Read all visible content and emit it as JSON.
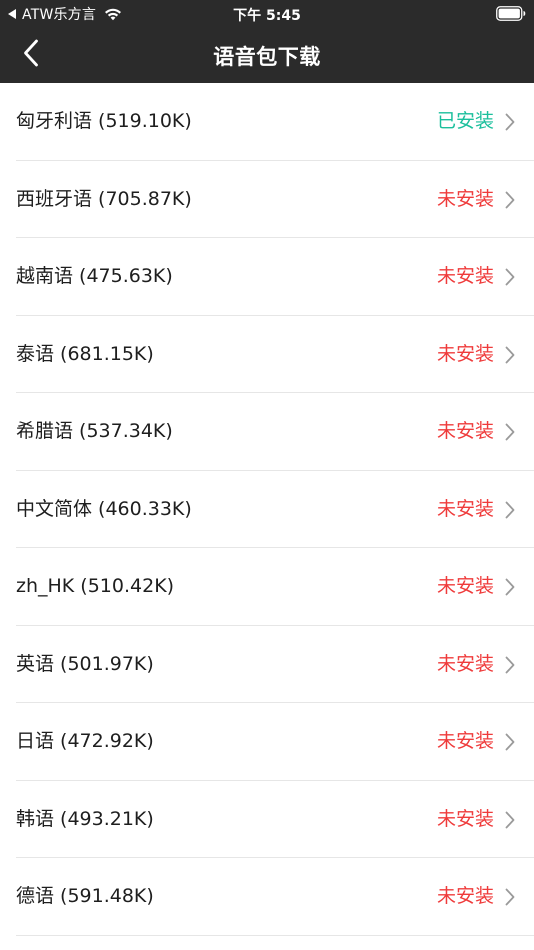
{
  "status_bar": {
    "carrier": "ATW乐方言",
    "time": "下午 5:45"
  },
  "nav": {
    "title": "语音包下载"
  },
  "colors": {
    "installed": "#1bbf9c",
    "not_installed": "#ef3b3b",
    "nav_background": "#2b2b2b"
  },
  "icons": {
    "back": "chevron-left-icon",
    "row_arrow": "chevron-right-icon"
  },
  "items": [
    {
      "label": "匈牙利语 (519.10K)",
      "status": "已安装",
      "installed": true
    },
    {
      "label": "西班牙语 (705.87K)",
      "status": "未安装",
      "installed": false
    },
    {
      "label": "越南语 (475.63K)",
      "status": "未安装",
      "installed": false
    },
    {
      "label": "泰语 (681.15K)",
      "status": "未安装",
      "installed": false
    },
    {
      "label": "希腊语 (537.34K)",
      "status": "未安装",
      "installed": false
    },
    {
      "label": "中文简体 (460.33K)",
      "status": "未安装",
      "installed": false
    },
    {
      "label": "zh_HK (510.42K)",
      "status": "未安装",
      "installed": false
    },
    {
      "label": "英语 (501.97K)",
      "status": "未安装",
      "installed": false
    },
    {
      "label": "日语 (472.92K)",
      "status": "未安装",
      "installed": false
    },
    {
      "label": "韩语 (493.21K)",
      "status": "未安装",
      "installed": false
    },
    {
      "label": "德语 (591.48K)",
      "status": "未安装",
      "installed": false
    }
  ]
}
